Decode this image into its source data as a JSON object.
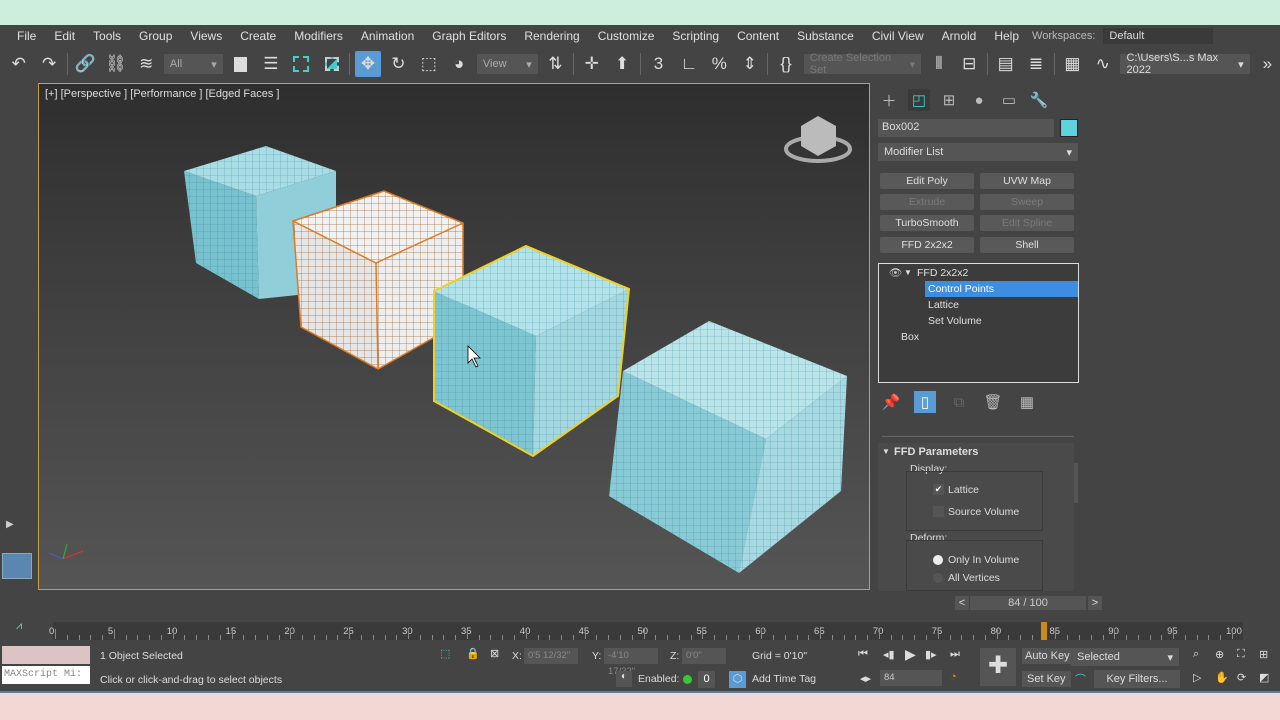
{
  "menu": {
    "items": [
      "File",
      "Edit",
      "Tools",
      "Group",
      "Views",
      "Create",
      "Modifiers",
      "Animation",
      "Graph Editors",
      "Rendering",
      "Customize",
      "Scripting",
      "Content",
      "Substance",
      "Civil View",
      "Arnold",
      "Help"
    ],
    "workspaces_label": "Workspaces:",
    "workspace_value": "Default"
  },
  "toolbar": {
    "selection_filter": "All",
    "ref_coord": "View",
    "selection_set_placeholder": "Create Selection Set",
    "project_path": "C:\\Users\\S...s Max 2022"
  },
  "viewport": {
    "label": "[+] [Perspective ] [Performance ] [Edged Faces ]"
  },
  "command_panel": {
    "object_name": "Box002",
    "object_color": "#5ed3dc",
    "modifier_list": "Modifier List",
    "modifier_buttons": [
      {
        "label": "Edit Poly",
        "enabled": true
      },
      {
        "label": "UVW Map",
        "enabled": true
      },
      {
        "label": "Extrude",
        "enabled": false
      },
      {
        "label": "Sweep",
        "enabled": false
      },
      {
        "label": "TurboSmooth",
        "enabled": true
      },
      {
        "label": "Edit Spline",
        "enabled": false
      },
      {
        "label": "FFD 2x2x2",
        "enabled": true
      },
      {
        "label": "Shell",
        "enabled": true
      }
    ],
    "stack": {
      "modifier": "FFD 2x2x2",
      "subobjects": [
        "Control Points",
        "Lattice",
        "Set Volume"
      ],
      "selected_subobject": "Control Points",
      "base": "Box"
    },
    "rollout": {
      "title": "FFD Parameters",
      "display_label": "Display:",
      "lattice_label": "Lattice",
      "lattice_checked": true,
      "source_volume_label": "Source Volume",
      "source_volume_checked": false,
      "deform_label": "Deform:",
      "only_in_volume_label": "Only In Volume",
      "all_vertices_label": "All Vertices",
      "deform_selected": "Only In Volume"
    }
  },
  "timeline": {
    "frame_display": "84 / 100",
    "current_frame": 84,
    "total_frames": 100,
    "ticks": [
      "0",
      "5",
      "10",
      "15",
      "20",
      "25",
      "30",
      "35",
      "40",
      "45",
      "50",
      "55",
      "60",
      "65",
      "70",
      "75",
      "80",
      "85",
      "90",
      "95",
      "100"
    ]
  },
  "status": {
    "maxscript_placeholder": "MAXScript Mi:",
    "selection_status": "1 Object Selected",
    "prompt": "Click or click-and-drag to select objects",
    "x_label": "X:",
    "x_value": "0'5 12/32\"",
    "y_label": "Y:",
    "y_value": "-4'10 17/32\"",
    "z_label": "Z:",
    "z_value": "0'0\"",
    "grid": "Grid = 0'10\"",
    "enabled_label": "Enabled:",
    "time_tag": "Add Time Tag",
    "frame_value": "84",
    "auto_key": "Auto Key",
    "set_key": "Set Key",
    "key_mode": "Selected",
    "key_filters": "Key Filters..."
  }
}
